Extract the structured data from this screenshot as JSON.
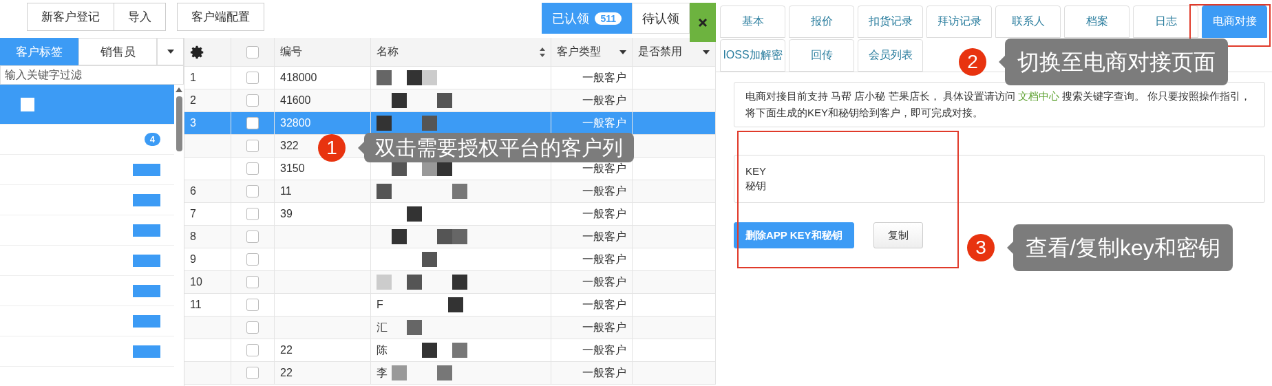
{
  "toolbar": {
    "buttons": [
      "新客户登记",
      "导入",
      "客户端配置"
    ]
  },
  "claim_tabs": [
    {
      "label": "已认领",
      "count": "511",
      "selected": true
    },
    {
      "label": "待认领",
      "selected": false
    }
  ],
  "sidebar": {
    "tabs": [
      {
        "label": "客户标签",
        "selected": true
      },
      {
        "label": "销售员",
        "selected": false
      }
    ],
    "filter": {
      "placeholder": "输入关键字过滤"
    },
    "items": [
      {
        "selected": true
      },
      {
        "selected": false,
        "badge": "4"
      },
      {
        "selected": false
      },
      {
        "selected": false
      },
      {
        "selected": false
      },
      {
        "selected": false
      },
      {
        "selected": false
      },
      {
        "selected": false
      },
      {
        "selected": false
      }
    ]
  },
  "table": {
    "columns": [
      {
        "label": "编号",
        "kind": "text"
      },
      {
        "label": "名称",
        "kind": "sort"
      },
      {
        "label": "客户类型",
        "kind": "filter"
      },
      {
        "label": "是否禁用",
        "kind": "filter"
      }
    ],
    "select_all_checked": false,
    "rows": [
      {
        "index": "1",
        "code": "418000",
        "type": "一般客户",
        "checked": false,
        "selected": false
      },
      {
        "index": "2",
        "code": "41600",
        "type": "一般客户",
        "checked": false,
        "selected": false
      },
      {
        "index": "3",
        "code": "32800",
        "type": "一般客户",
        "checked": false,
        "selected": true
      },
      {
        "code": "322",
        "checked": false,
        "selected": false
      },
      {
        "code": "3150",
        "type": "一般客户",
        "checked": false,
        "selected": false
      },
      {
        "index": "6",
        "code": "11",
        "type": "一般客户",
        "checked": false,
        "selected": false
      },
      {
        "index": "7",
        "code": "39",
        "type": "一般客户",
        "checked": false,
        "selected": false
      },
      {
        "index": "8",
        "type": "一般客户",
        "checked": false,
        "selected": false
      },
      {
        "index": "9",
        "type": "一般客户",
        "checked": false,
        "selected": false
      },
      {
        "index": "10",
        "type": "一般客户",
        "checked": false,
        "selected": false
      },
      {
        "index": "11",
        "name": "F",
        "type": "一般客户",
        "checked": false,
        "selected": false
      },
      {
        "name": "汇",
        "type": "一般客户",
        "checked": false,
        "selected": false
      },
      {
        "code": "22",
        "name": "陈",
        "type": "一般客户",
        "checked": false,
        "selected": false
      },
      {
        "code": "22",
        "name": "李",
        "type": "一般客户",
        "checked": false,
        "selected": false
      }
    ]
  },
  "detail": {
    "tabs": [
      {
        "label": "基本",
        "selected": false
      },
      {
        "label": "报价",
        "selected": false
      },
      {
        "label": "扣货记录",
        "selected": false
      },
      {
        "label": "拜访记录",
        "selected": false
      },
      {
        "label": "联系人",
        "selected": false
      },
      {
        "label": "档案",
        "selected": false
      },
      {
        "label": "日志",
        "selected": false
      },
      {
        "label": "电商对接",
        "selected": true
      },
      {
        "label": "IOSS加解密",
        "selected": false
      },
      {
        "label": "回传",
        "selected": false
      },
      {
        "label": "会员列表",
        "selected": false
      }
    ],
    "info": {
      "before": "电商对接目前支持 马帮 店小秘 芒果店长， 具体设置请访问 ",
      "link": "文档中心",
      "after": " 搜索关键字查询。 你只要按照操作指引，将下面生成的KEY和秘钥给到客户，即可完成对接。"
    },
    "keys": [
      "KEY",
      "秘钥"
    ],
    "buttons": [
      {
        "label": "删除APP KEY和秘钥",
        "kind": "primary"
      },
      {
        "label": "复制",
        "kind": "default"
      }
    ]
  },
  "annotations": [
    {
      "number": "1",
      "text": "双击需要授权平台的客户列"
    },
    {
      "number": "2",
      "text": "切换至电商对接页面"
    },
    {
      "number": "3",
      "text": "查看/复制key和密钥"
    }
  ]
}
